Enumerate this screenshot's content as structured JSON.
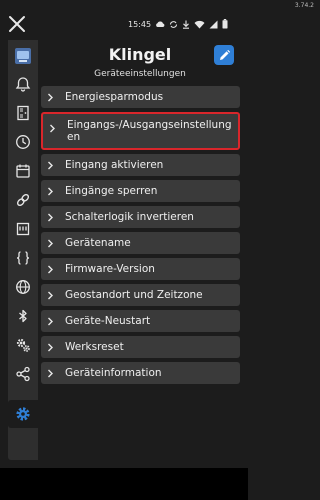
{
  "app": {
    "version": "3.74.2",
    "title": "Klingel",
    "subtitle": "Geräteeinstellungen"
  },
  "status_bar": {
    "time": "15:45",
    "icons": [
      "cloud-icon",
      "sync-icon",
      "download-icon",
      "wifi-icon",
      "signal-icon",
      "battery-icon"
    ]
  },
  "sidebar": {
    "items": [
      {
        "name": "avatar",
        "icon": "device-avatar-icon"
      },
      {
        "name": "bell",
        "icon": "bell-icon"
      },
      {
        "name": "door",
        "icon": "door-icon"
      },
      {
        "name": "clock",
        "icon": "clock-icon"
      },
      {
        "name": "calendar",
        "icon": "calendar-icon"
      },
      {
        "name": "link",
        "icon": "link-icon"
      },
      {
        "name": "panel",
        "icon": "display-panel-icon"
      },
      {
        "name": "code",
        "icon": "code-braces-icon"
      },
      {
        "name": "globe",
        "icon": "globe-icon"
      },
      {
        "name": "bluetooth",
        "icon": "bluetooth-icon"
      },
      {
        "name": "gears",
        "icon": "gears-icon"
      },
      {
        "name": "share",
        "icon": "share-icon"
      },
      {
        "name": "settings",
        "icon": "settings-gear-icon",
        "active": true
      }
    ]
  },
  "menu": {
    "items": [
      {
        "label": "Energiesparmodus"
      },
      {
        "label": "Eingangs-/Ausgangseinstellungen",
        "label_line1": "Eingangs-/Ausgangseinstellung",
        "label_line2": "en",
        "highlighted": true
      },
      {
        "label": "Eingang aktivieren"
      },
      {
        "label": "Eingänge sperren"
      },
      {
        "label": "Schalterlogik invertieren"
      },
      {
        "label": "Gerätename"
      },
      {
        "label": "Firmware-Version"
      },
      {
        "label": "Geostandort und Zeitzone"
      },
      {
        "label": "Geräte-Neustart"
      },
      {
        "label": "Werksreset"
      },
      {
        "label": "Geräteinformation"
      }
    ]
  },
  "colors": {
    "accent": "#2f7fd6",
    "highlight_border": "#d9262b",
    "background": "#1c1c1c",
    "item_bg": "#3a3a3a"
  }
}
